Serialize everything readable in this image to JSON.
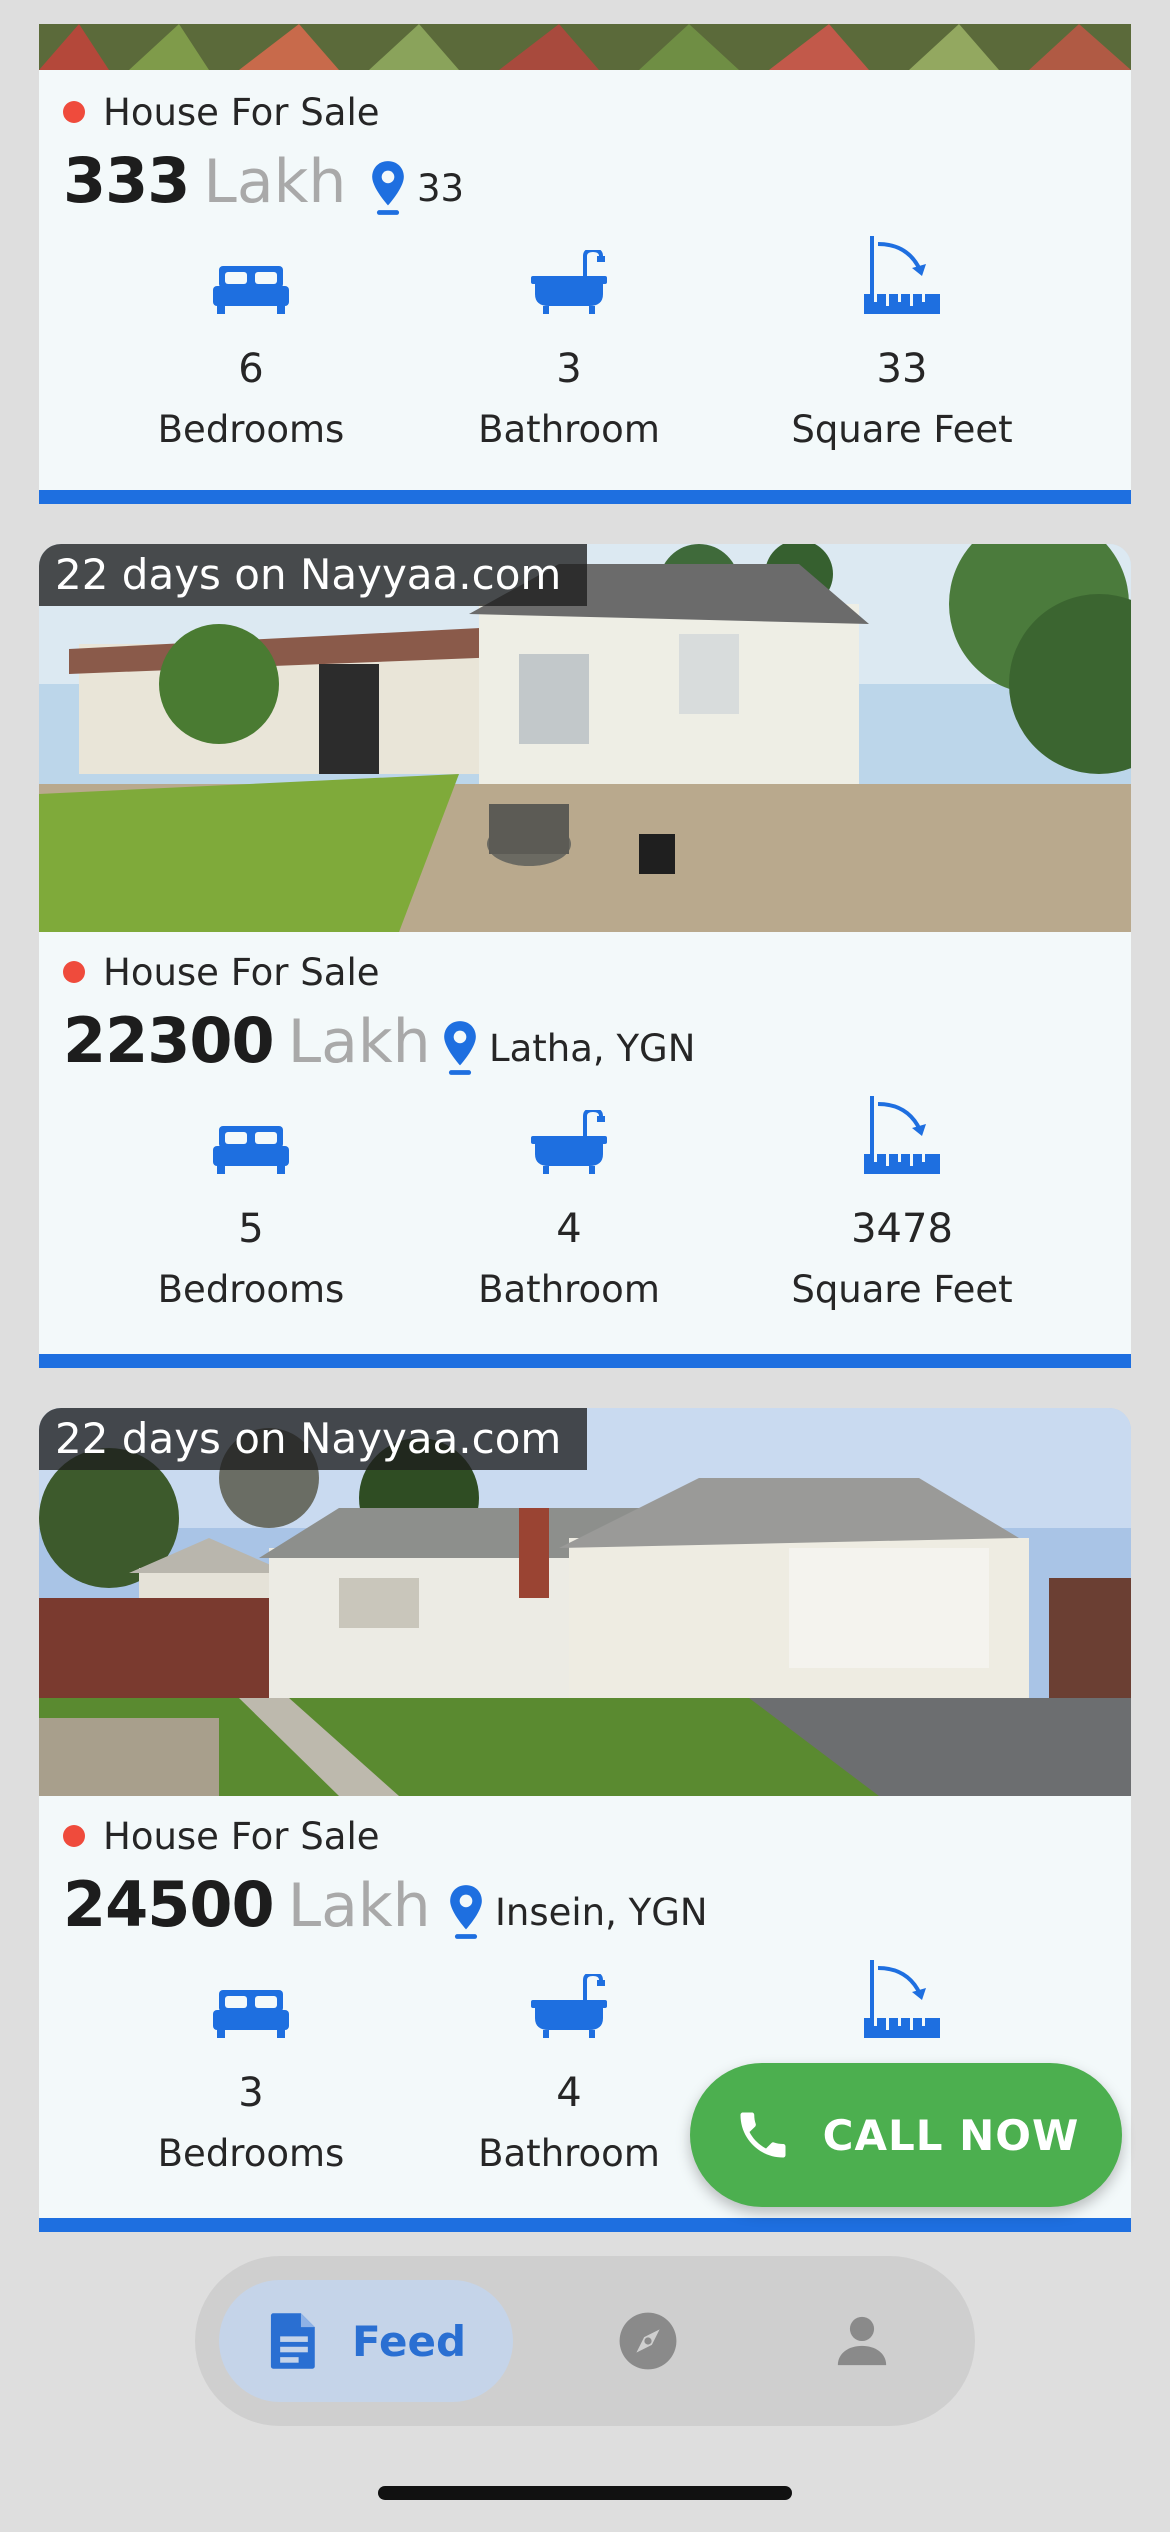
{
  "listings": [
    {
      "status": "House For Sale",
      "price": "333",
      "unit": "Lakh",
      "location": "33",
      "bedrooms": "6",
      "bathrooms": "3",
      "sqft": "33"
    },
    {
      "days_badge": "22 days on Nayyaa.com",
      "status": "House For Sale",
      "price": "22300",
      "unit": "Lakh",
      "location": "Latha, YGN",
      "bedrooms": "5",
      "bathrooms": "4",
      "sqft": "3478"
    },
    {
      "days_badge": "22 days on Nayyaa.com",
      "status": "House For Sale",
      "price": "24500",
      "unit": "Lakh",
      "location": "Insein, YGN",
      "bedrooms": "3",
      "bathrooms": "4"
    }
  ],
  "labels": {
    "bedrooms": "Bedrooms",
    "bathroom": "Bathroom",
    "square_feet": "Square Feet"
  },
  "call_button": "CALL NOW",
  "nav": {
    "feed": "Feed",
    "items": [
      "feed-icon",
      "compass-icon",
      "person-icon"
    ]
  },
  "colors": {
    "accent_blue": "#1e6fe0",
    "status_red": "#ef4b3c",
    "call_green": "#4caf4f"
  }
}
